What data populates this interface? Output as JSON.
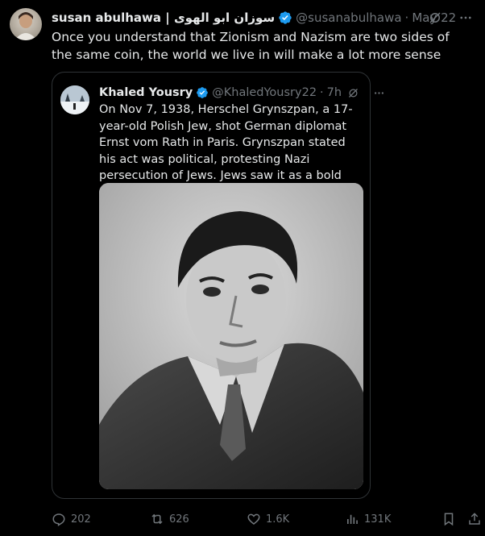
{
  "author": {
    "name": "susan abulhawa | سوزان ابو الهوى",
    "handle": "@susanabulhawa",
    "date": "May 22"
  },
  "post": {
    "text": "Once you understand that Zionism and Nazism are two sides of the same coin, the world we live in will make a lot more sense"
  },
  "quoted": {
    "name": "Khaled Yousry",
    "handle": "@KhaledYousry22",
    "time": "7h",
    "text": "On Nov 7, 1938, Herschel Grynszpan, a 17-year-old Polish Jew, shot German diplomat Ernst vom Rath in Paris. Grynszpan stated his act was political, protesting Nazi persecution of Jews. Jews saw it as a bold act of resistance."
  },
  "stats": {
    "replies": "202",
    "reposts": "626",
    "likes": "1.6K",
    "views": "131K"
  },
  "colors": {
    "background": "#000000",
    "text": "#e7e9ea",
    "muted": "#71767b",
    "verified": "#1d9bf0",
    "border": "#2f3336"
  },
  "icons": [
    "grok-icon",
    "more-icon",
    "verified-badge-icon",
    "reply-icon",
    "repost-icon",
    "like-icon",
    "views-icon",
    "bookmark-icon",
    "share-icon"
  ]
}
